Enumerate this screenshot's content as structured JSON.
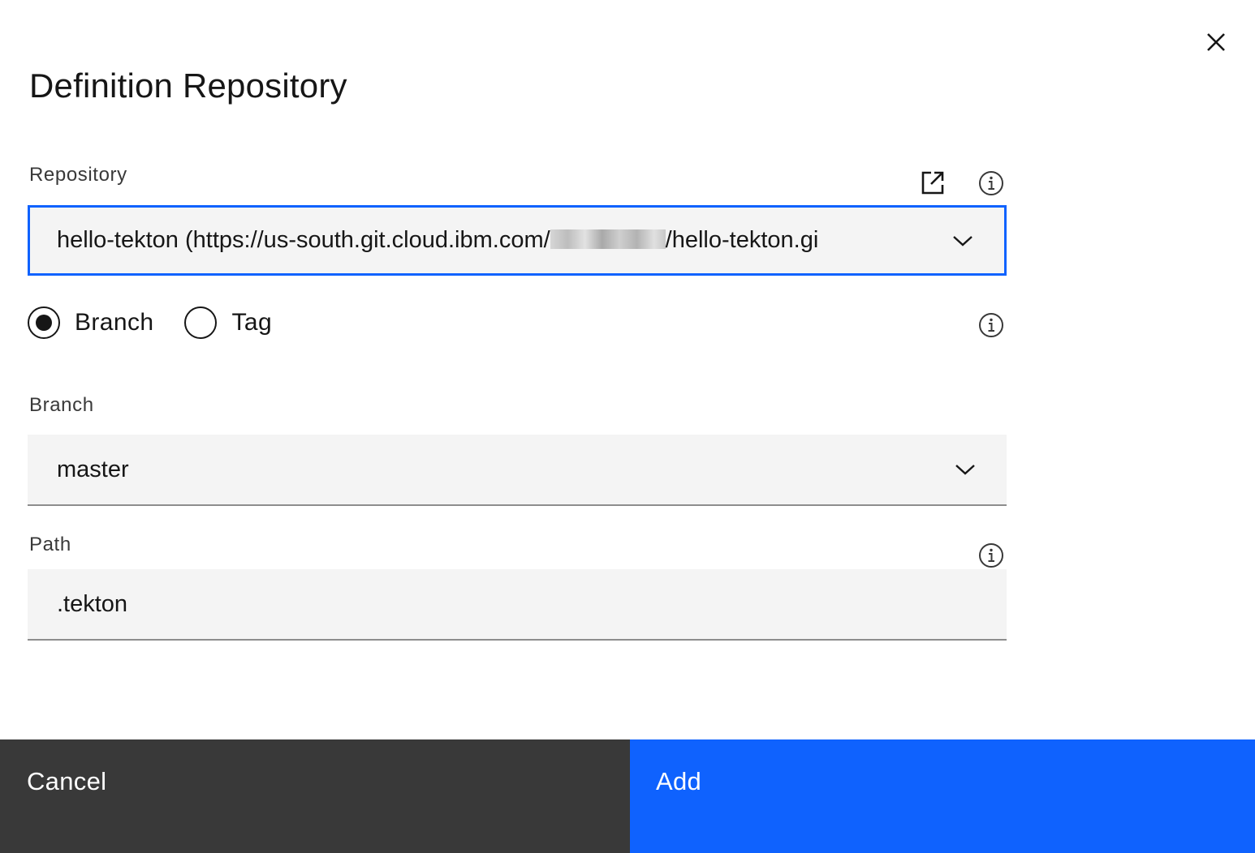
{
  "modal": {
    "title": "Definition Repository",
    "close_icon": "close-icon"
  },
  "repository": {
    "label": "Repository",
    "value_prefix": "hello-tekton (https://us-south.git.cloud.ibm.com/",
    "value_redacted": "[redacted]",
    "value_suffix": "/hello-tekton.gi",
    "state": "focused",
    "external_link_icon": "launch-icon",
    "info_icon": "information-icon",
    "dropdown_icon": "chevron-down-icon"
  },
  "ref_type": {
    "options": [
      {
        "label": "Branch",
        "selected": true
      },
      {
        "label": "Tag",
        "selected": false
      }
    ],
    "info_icon": "information-icon"
  },
  "branch": {
    "label": "Branch",
    "value": "master",
    "dropdown_icon": "chevron-down-icon"
  },
  "path": {
    "label": "Path",
    "value": ".tekton",
    "info_icon": "information-icon"
  },
  "footer": {
    "cancel_label": "Cancel",
    "add_label": "Add"
  },
  "colors": {
    "primary": "#0f62fe",
    "secondary_button": "#393939",
    "field_background": "#f4f4f4"
  }
}
